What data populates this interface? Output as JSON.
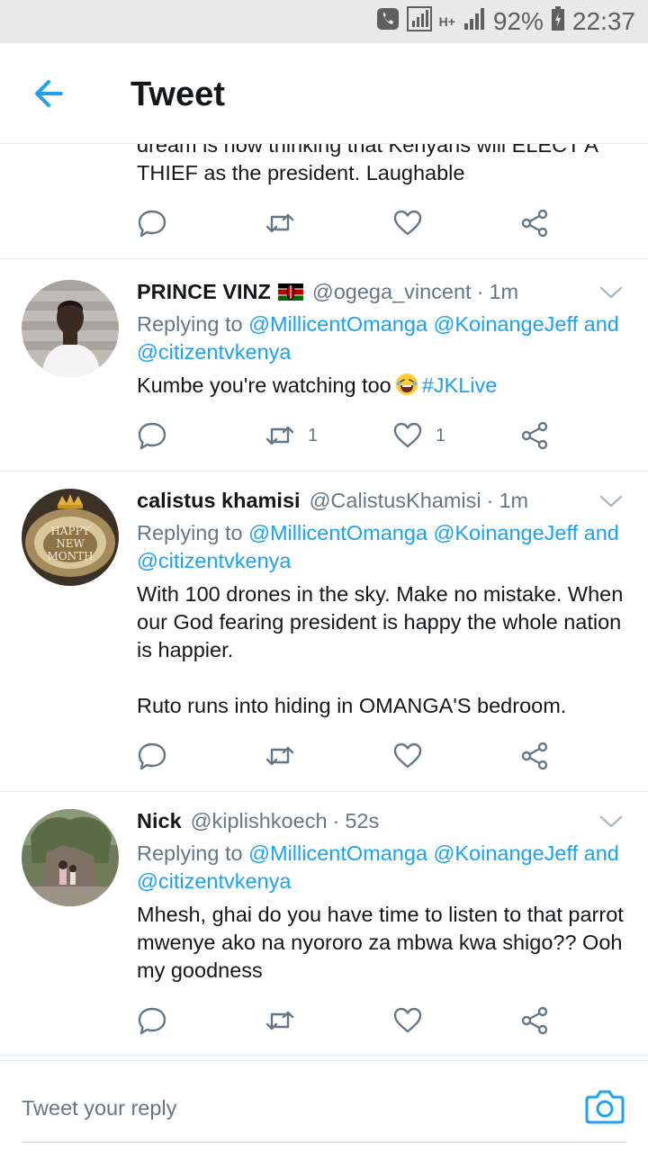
{
  "status_bar": {
    "battery": "92%",
    "time": "22:37",
    "network": "H+"
  },
  "header": {
    "title": "Tweet"
  },
  "partial_tweet": {
    "text": "dream is now thinking that Kenyans will ELECT A THIEF as the president. Laughable"
  },
  "tweets": [
    {
      "name": "PRINCE VINZ",
      "handle": "@ogega_vincent",
      "dot": "·",
      "time": "1m",
      "replying_prefix": "Replying to ",
      "mention1": "@MillicentOmanga",
      "mention2": "@KoinangeJeff",
      "and_word": " and ",
      "mention3": "@citizentvkenya",
      "body_text": "Kumbe you're watching too",
      "hashtag": "#JKLive",
      "retweets": "1",
      "likes": "1"
    },
    {
      "name": "calistus khamisi",
      "handle": "@CalistusKhamisi",
      "dot": "·",
      "time": "1m",
      "avatar_text_1": "HAPPY",
      "avatar_text_2": "NEW",
      "avatar_text_3": "MONTH",
      "replying_prefix": "Replying to ",
      "mention1": "@MillicentOmanga",
      "mention2": "@KoinangeJeff",
      "and_word": " and ",
      "mention3": "@citizentvkenya",
      "body_text": "With 100 drones in the sky.  Make no mistake. When our God fearing president is happy the whole nation is happier.\n\nRuto runs into hiding in OMANGA'S bedroom.",
      "retweets": "",
      "likes": ""
    },
    {
      "name": "Nick",
      "handle": "@kiplishkoech",
      "dot": "·",
      "time": "52s",
      "replying_prefix": "Replying to ",
      "mention1": "@MillicentOmanga",
      "mention2": "@KoinangeJeff",
      "and_word": " and ",
      "mention3": "@citizentvkenya",
      "body_text": "Mhesh, ghai do you have time to listen to that parrot mwenye ako na nyororo za mbwa kwa shigo?? Ooh my goodness",
      "retweets": "",
      "likes": ""
    }
  ],
  "reply_bar": {
    "placeholder": "Tweet your reply"
  },
  "icons": {
    "back": "arrow-left-icon",
    "reply": "reply-icon",
    "retweet": "retweet-icon",
    "like": "heart-icon",
    "share": "share-icon",
    "caret": "chevron-down-icon",
    "camera": "camera-icon",
    "emoji": "laughing-emoji-icon",
    "flag": "kenya-flag-icon"
  },
  "colors": {
    "accent": "#1da1f2",
    "secondary_text": "#657786",
    "divider": "#e1e8ed",
    "status_bar_bg": "#e9e9e9"
  }
}
